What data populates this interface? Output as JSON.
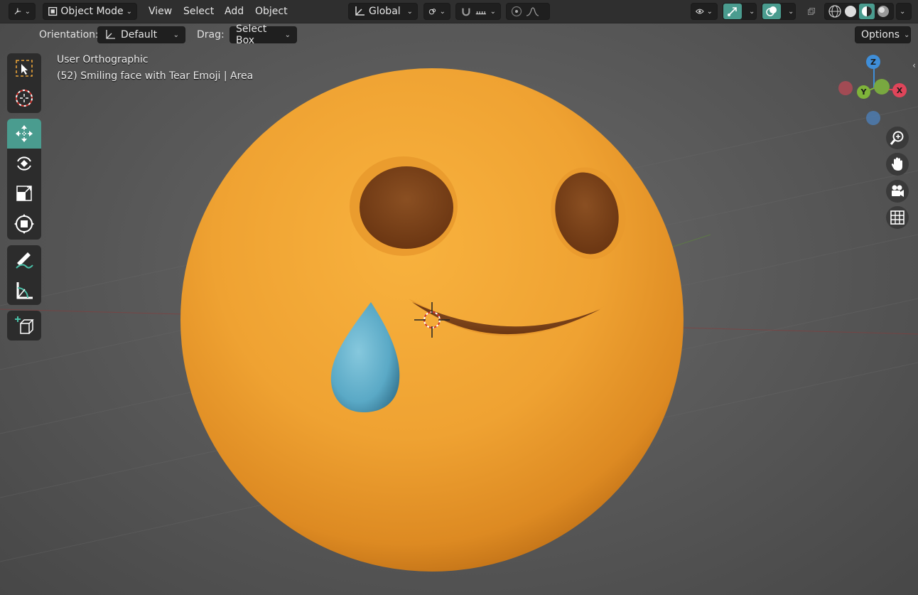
{
  "header": {
    "editor_type_icon": "axis-icon",
    "mode": "Object Mode",
    "menus": [
      "View",
      "Select",
      "Add",
      "Object"
    ],
    "transform_orientation": "Global"
  },
  "tool_settings": {
    "orientation_label": "Orientation:",
    "orientation_value": "Default",
    "drag_label": "Drag:",
    "drag_value": "Select Box",
    "options_label": "Options"
  },
  "viewport": {
    "view_name": "User Orthographic",
    "object_info": "(52) Smiling face with Tear Emoji | Area"
  },
  "gizmo": {
    "z": "Z",
    "y": "Y",
    "x": "X"
  },
  "toolbar": {
    "tools": [
      "select-box",
      "cursor",
      "move",
      "rotate",
      "scale",
      "transform",
      "annotate",
      "measure",
      "add-cube"
    ],
    "active_tool": "move"
  },
  "colors": {
    "accent": "#4a9c8f",
    "emoji_yellow": "#f2a636",
    "tear_blue": "#5aa9c6",
    "axis_x": "#e0455a",
    "axis_y": "#7fb43a",
    "axis_z": "#3f8ed8"
  }
}
